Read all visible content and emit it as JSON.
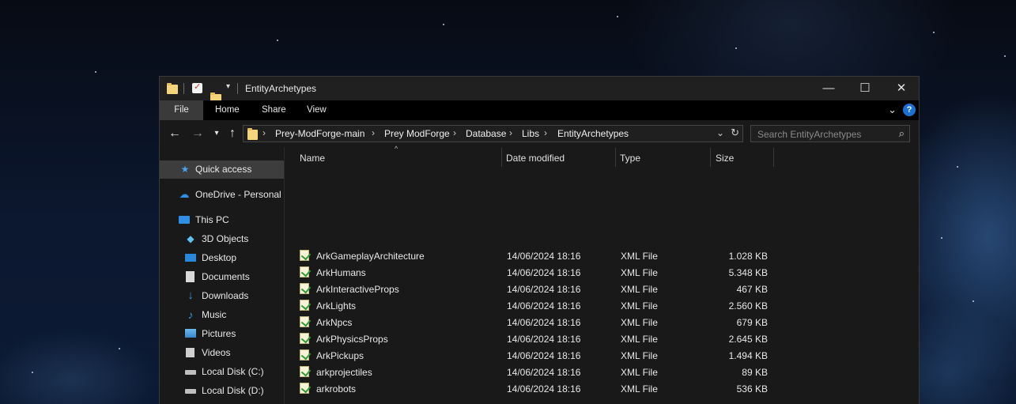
{
  "window": {
    "title": "EntityArchetypes",
    "controls": {
      "minimize": "—",
      "maximize": "☐",
      "close": "✕"
    }
  },
  "ribbon": {
    "tabs": [
      "File",
      "Home",
      "Share",
      "View"
    ],
    "help": "?"
  },
  "address": {
    "crumbs": [
      "Prey-ModForge-main",
      "Prey ModForge",
      "Database",
      "Libs",
      "EntityArchetypes"
    ]
  },
  "search": {
    "placeholder": "Search EntityArchetypes"
  },
  "navpane": {
    "items": [
      {
        "label": "Quick access",
        "icon": "star-icon"
      },
      {
        "label": "OneDrive - Personal",
        "icon": "cloud-icon"
      },
      {
        "label": "This PC",
        "icon": "monitor-icon"
      },
      {
        "label": "3D Objects",
        "icon": "cube-icon"
      },
      {
        "label": "Desktop",
        "icon": "desktop-icon"
      },
      {
        "label": "Documents",
        "icon": "document-icon"
      },
      {
        "label": "Downloads",
        "icon": "download-icon"
      },
      {
        "label": "Music",
        "icon": "music-icon"
      },
      {
        "label": "Pictures",
        "icon": "pictures-icon"
      },
      {
        "label": "Videos",
        "icon": "video-icon"
      },
      {
        "label": "Local Disk (C:)",
        "icon": "drive-icon"
      },
      {
        "label": "Local Disk (D:)",
        "icon": "drive-icon"
      }
    ]
  },
  "filelist": {
    "columns": [
      "Name",
      "Date modified",
      "Type",
      "Size"
    ],
    "rows": [
      {
        "name": "ArkGameplayArchitecture",
        "date": "14/06/2024 18:16",
        "type": "XML File",
        "size": "1.028 KB"
      },
      {
        "name": "ArkHumans",
        "date": "14/06/2024 18:16",
        "type": "XML File",
        "size": "5.348 KB"
      },
      {
        "name": "ArkInteractiveProps",
        "date": "14/06/2024 18:16",
        "type": "XML File",
        "size": "467 KB"
      },
      {
        "name": "ArkLights",
        "date": "14/06/2024 18:16",
        "type": "XML File",
        "size": "2.560 KB"
      },
      {
        "name": "ArkNpcs",
        "date": "14/06/2024 18:16",
        "type": "XML File",
        "size": "679 KB"
      },
      {
        "name": "ArkPhysicsProps",
        "date": "14/06/2024 18:16",
        "type": "XML File",
        "size": "2.645 KB"
      },
      {
        "name": "ArkPickups",
        "date": "14/06/2024 18:16",
        "type": "XML File",
        "size": "1.494 KB"
      },
      {
        "name": "arkprojectiles",
        "date": "14/06/2024 18:16",
        "type": "XML File",
        "size": "89 KB"
      },
      {
        "name": "arkrobots",
        "date": "14/06/2024 18:16",
        "type": "XML File",
        "size": "536 KB"
      }
    ]
  },
  "colors": {
    "accent": "#1c72d4",
    "window_bg": "#191919",
    "selected": "#3d3d3d"
  }
}
